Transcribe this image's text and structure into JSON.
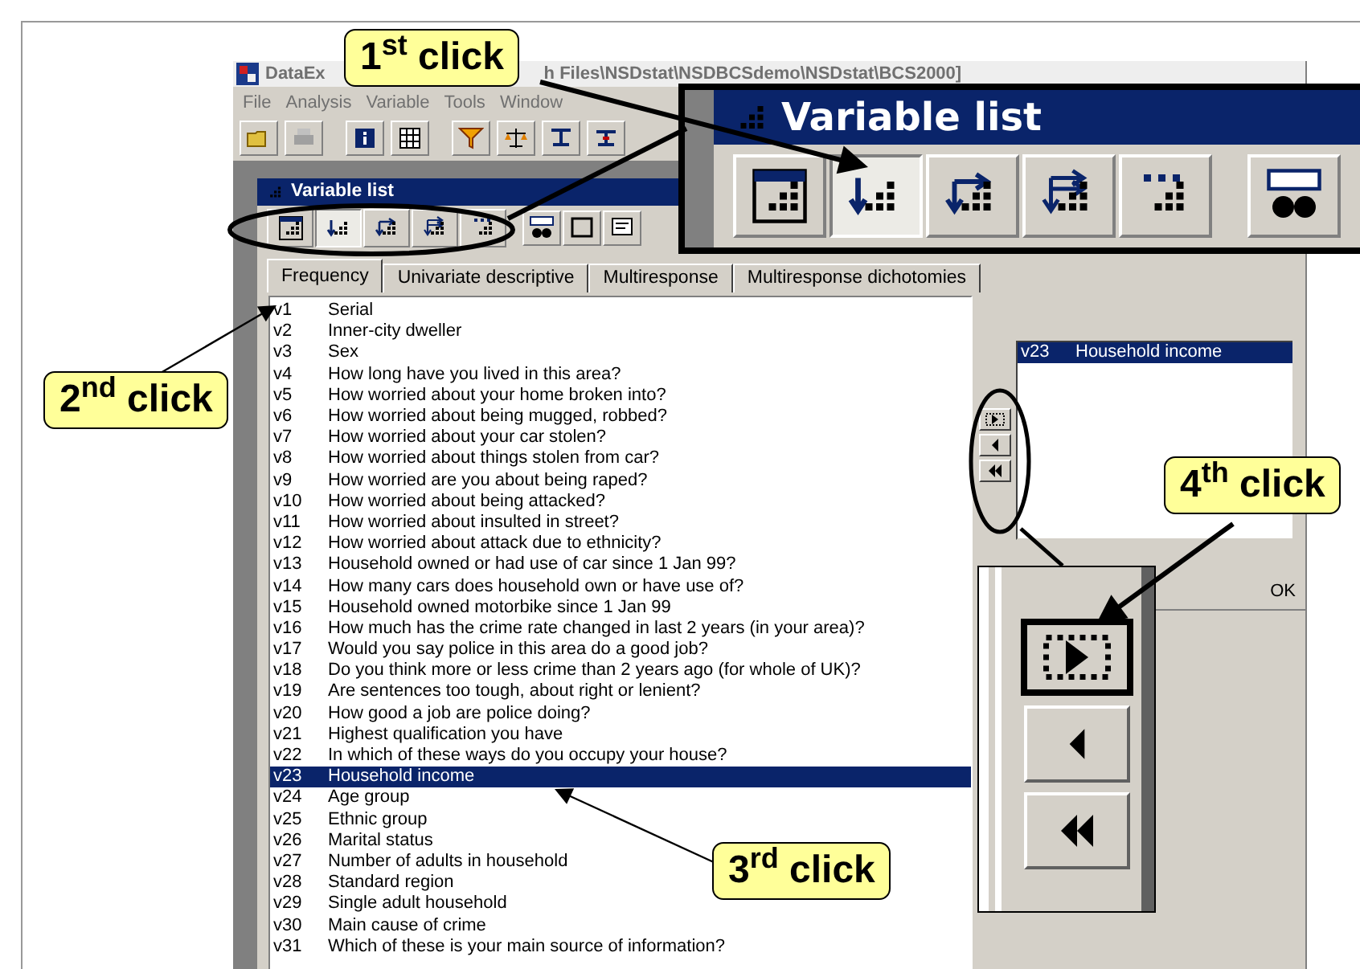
{
  "window": {
    "title_start": "DataEx",
    "title_end": "h Files\\NSDstat\\NSDBCSdemo\\NSDstat\\BCS2000]"
  },
  "menu": [
    "File",
    "Analysis",
    "Variable",
    "Tools",
    "Window"
  ],
  "child_window": {
    "title": "Variable list"
  },
  "tools": [
    {
      "kind": "window",
      "pressed": false
    },
    {
      "kind": "down",
      "pressed": true
    },
    {
      "kind": "down-right",
      "pressed": false
    },
    {
      "kind": "down-double",
      "pressed": false
    },
    {
      "kind": "dots",
      "pressed": false
    }
  ],
  "tabs": [
    {
      "label": "Frequency",
      "selected": true
    },
    {
      "label": "Univariate descriptive",
      "selected": false
    },
    {
      "label": "Multiresponse",
      "selected": false
    },
    {
      "label": "Multiresponse dichotomies",
      "selected": false
    }
  ],
  "variables": [
    {
      "code": "v1",
      "label": "Serial",
      "selected": false
    },
    {
      "code": "v2",
      "label": "Inner-city dweller",
      "selected": false
    },
    {
      "code": "v3",
      "label": "Sex",
      "selected": false
    },
    {
      "code": "v4",
      "label": "How long have you lived in this area?",
      "selected": false
    },
    {
      "code": "v5",
      "label": "How worried about your home broken into?",
      "selected": false
    },
    {
      "code": "v6",
      "label": "How worried about being mugged, robbed?",
      "selected": false
    },
    {
      "code": "v7",
      "label": "How worried about your car stolen?",
      "selected": false
    },
    {
      "code": "v8",
      "label": "How worried about things stolen from car?",
      "selected": false
    },
    {
      "code": "v9",
      "label": "How worried are you about being raped?",
      "selected": false
    },
    {
      "code": "v10",
      "label": "How worried about being attacked?",
      "selected": false
    },
    {
      "code": "v11",
      "label": "How worried about insulted in street?",
      "selected": false
    },
    {
      "code": "v12",
      "label": "How worried about attack due to ethnicity?",
      "selected": false
    },
    {
      "code": "v13",
      "label": "Household owned or had use of car since 1 Jan 99?",
      "selected": false
    },
    {
      "code": "v14",
      "label": "How many cars does household own or have use of?",
      "selected": false
    },
    {
      "code": "v15",
      "label": "Household owned motorbike since 1 Jan 99",
      "selected": false
    },
    {
      "code": "v16",
      "label": "How much has the crime rate changed in last 2 years (in your area)?",
      "selected": false
    },
    {
      "code": "v17",
      "label": "Would you say police in this area do a good job?",
      "selected": false
    },
    {
      "code": "v18",
      "label": "Do you think more or less crime than 2 years ago (for whole of UK)?",
      "selected": false
    },
    {
      "code": "v19",
      "label": "Are sentences too tough, about right or lenient?",
      "selected": false
    },
    {
      "code": "v20",
      "label": "How good a job are police doing?",
      "selected": false
    },
    {
      "code": "v21",
      "label": "Highest qualification you have",
      "selected": false
    },
    {
      "code": "v22",
      "label": "In which of these ways do you occupy your house?",
      "selected": false
    },
    {
      "code": "v23",
      "label": "Household income",
      "selected": true
    },
    {
      "code": "v24",
      "label": "Age group",
      "selected": false
    },
    {
      "code": "v25",
      "label": "Ethnic group",
      "selected": false
    },
    {
      "code": "v26",
      "label": "Marital status",
      "selected": false
    },
    {
      "code": "v27",
      "label": "Number of adults in household",
      "selected": false
    },
    {
      "code": "v28",
      "label": "Standard region",
      "selected": false
    },
    {
      "code": "v29",
      "label": "Single adult household",
      "selected": false
    },
    {
      "code": "v30",
      "label": "Main cause of crime",
      "selected": false
    },
    {
      "code": "v31",
      "label": "Which of these is your main source of information?",
      "selected": false
    }
  ],
  "selected_variables": [
    {
      "code": "v23",
      "label": "Household income"
    }
  ],
  "ok_label": "OK",
  "zoom_inset": {
    "title": "Variable list"
  },
  "callouts": [
    "1$^{st}$ click",
    "2$^{nd}$ click",
    "3$^{rd}$ click",
    "4$^{th}$ click"
  ]
}
